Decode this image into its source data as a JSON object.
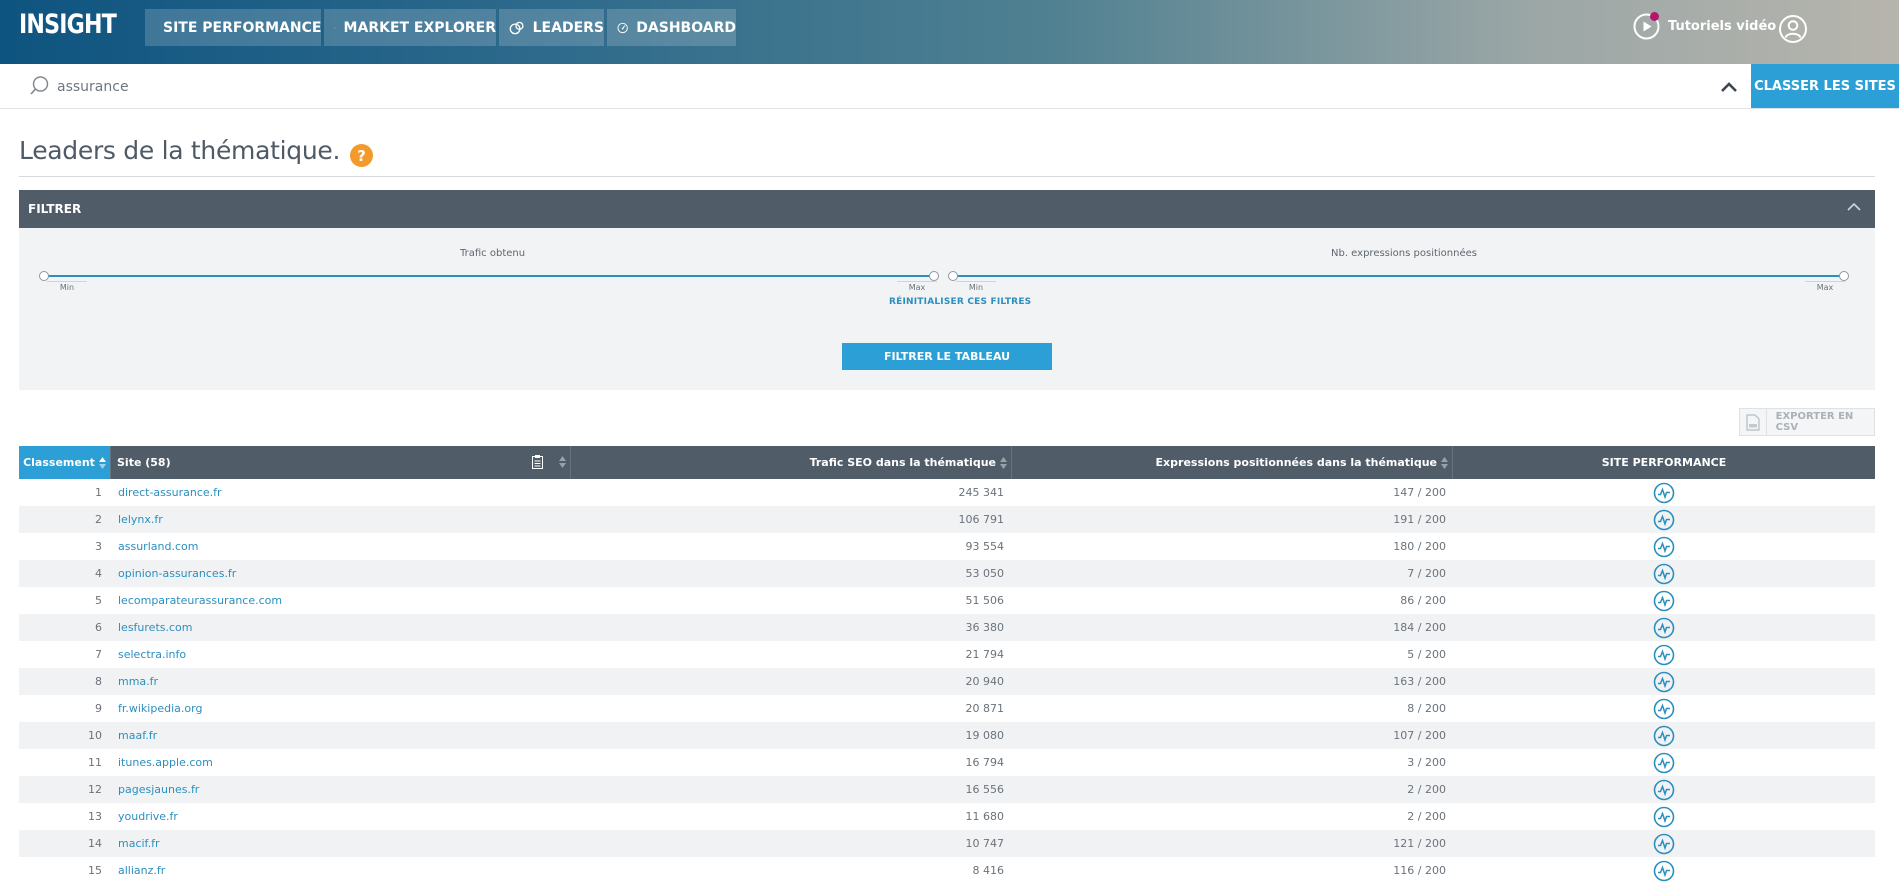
{
  "app": {
    "logo": "INSIGHT"
  },
  "nav": [
    {
      "label": "SITE PERFORMANCE",
      "icon": "chart-pulse-icon"
    },
    {
      "label": "MARKET EXPLORER",
      "icon": "magnifier-icon"
    },
    {
      "label": "LEADERS",
      "icon": "leaders-icon"
    },
    {
      "label": "DASHBOARD",
      "icon": "gauge-icon"
    }
  ],
  "header": {
    "tutorials_label": "Tutoriels vidéo"
  },
  "search": {
    "value": "assurance",
    "submit_label": "CLASSER LES SITES"
  },
  "page": {
    "title": "Leaders de la thématique.",
    "help": "?"
  },
  "filter": {
    "header": "FILTRER",
    "slider1": {
      "label": "Trafic obtenu",
      "min": "Min",
      "max": "Max"
    },
    "slider2": {
      "label": "Nb. expressions positionnées",
      "min": "Min",
      "max": "Max"
    },
    "reset_label": "RÉINITIALISER CES FILTRES",
    "apply_label": "FILTRER LE TABLEAU"
  },
  "export": {
    "label": "EXPORTER EN CSV"
  },
  "table": {
    "columns": {
      "rank": "Classement",
      "site": "Site (58)",
      "traffic": "Trafic SEO dans la thématique",
      "expressions": "Expressions positionnées dans la thématique",
      "performance": "SITE PERFORMANCE"
    },
    "rows": [
      {
        "rank": "1",
        "site": "direct-assurance.fr",
        "traffic": "245 341",
        "expressions": "147 / 200"
      },
      {
        "rank": "2",
        "site": "lelynx.fr",
        "traffic": "106 791",
        "expressions": "191 / 200"
      },
      {
        "rank": "3",
        "site": "assurland.com",
        "traffic": "93 554",
        "expressions": "180 / 200"
      },
      {
        "rank": "4",
        "site": "opinion-assurances.fr",
        "traffic": "53 050",
        "expressions": "7 / 200"
      },
      {
        "rank": "5",
        "site": "lecomparateurassurance.com",
        "traffic": "51 506",
        "expressions": "86 / 200"
      },
      {
        "rank": "6",
        "site": "lesfurets.com",
        "traffic": "36 380",
        "expressions": "184 / 200"
      },
      {
        "rank": "7",
        "site": "selectra.info",
        "traffic": "21 794",
        "expressions": "5 / 200"
      },
      {
        "rank": "8",
        "site": "mma.fr",
        "traffic": "20 940",
        "expressions": "163 / 200"
      },
      {
        "rank": "9",
        "site": "fr.wikipedia.org",
        "traffic": "20 871",
        "expressions": "8 / 200"
      },
      {
        "rank": "10",
        "site": "maaf.fr",
        "traffic": "19 080",
        "expressions": "107 / 200"
      },
      {
        "rank": "11",
        "site": "itunes.apple.com",
        "traffic": "16 794",
        "expressions": "3 / 200"
      },
      {
        "rank": "12",
        "site": "pagesjaunes.fr",
        "traffic": "16 556",
        "expressions": "2 / 200"
      },
      {
        "rank": "13",
        "site": "youdrive.fr",
        "traffic": "11 680",
        "expressions": "2 / 200"
      },
      {
        "rank": "14",
        "site": "macif.fr",
        "traffic": "10 747",
        "expressions": "121 / 200"
      },
      {
        "rank": "15",
        "site": "allianz.fr",
        "traffic": "8 416",
        "expressions": "116 / 200"
      }
    ]
  },
  "colors": {
    "accent": "#2b9fd6",
    "header_dark": "#505c68",
    "help": "#f39a2a"
  }
}
